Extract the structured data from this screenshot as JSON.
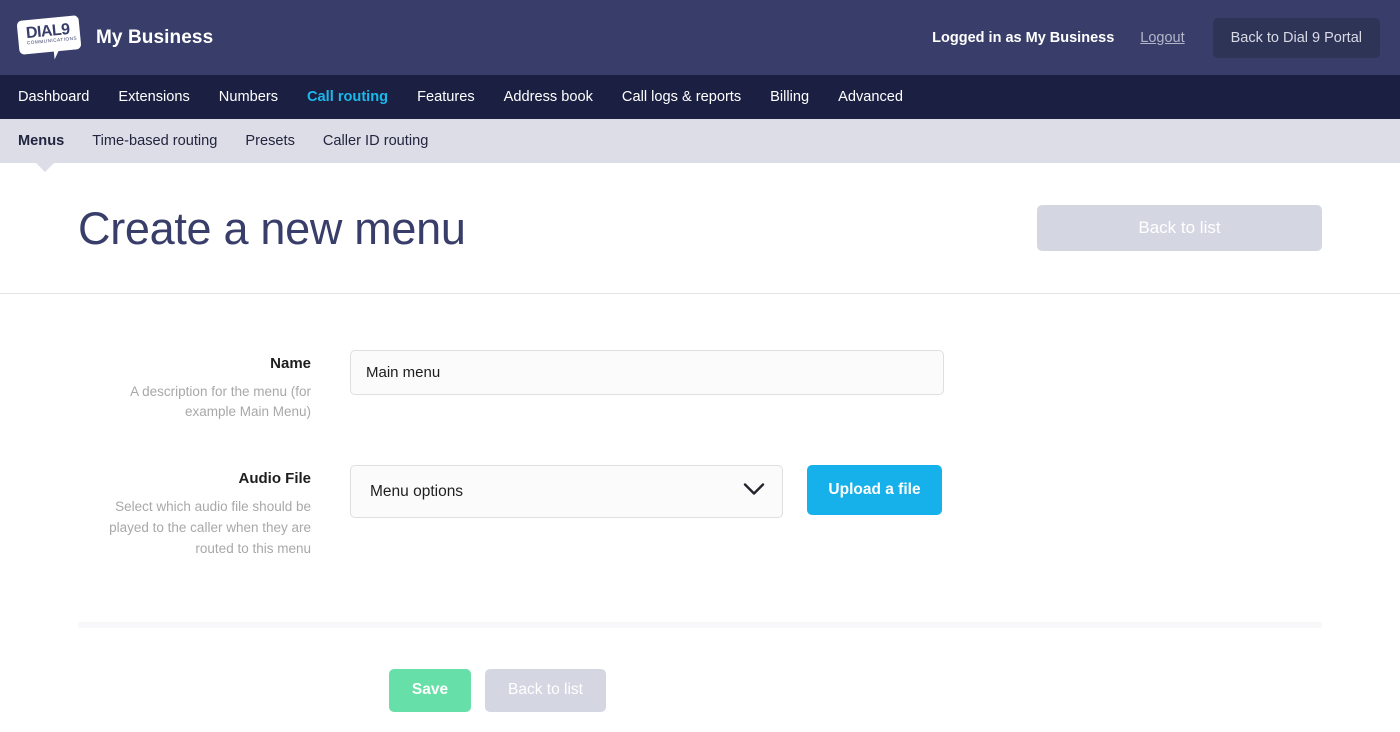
{
  "header": {
    "logo": {
      "icon": "dial9-speech-bubble-logo",
      "primary_text": "DIAL9",
      "trademark": "™",
      "secondary_text": "COMMUNICATIONS"
    },
    "brand_name": "My Business",
    "logged_in_text": "Logged in as My Business",
    "logout_label": "Logout",
    "portal_button_label": "Back to Dial 9 Portal"
  },
  "main_nav": {
    "active": "Call routing",
    "items": [
      {
        "label": "Dashboard",
        "active": false
      },
      {
        "label": "Extensions",
        "active": false
      },
      {
        "label": "Numbers",
        "active": false
      },
      {
        "label": "Call routing",
        "active": true
      },
      {
        "label": "Features",
        "active": false
      },
      {
        "label": "Address book",
        "active": false
      },
      {
        "label": "Call logs & reports",
        "active": false
      },
      {
        "label": "Billing",
        "active": false
      },
      {
        "label": "Advanced",
        "active": false
      }
    ]
  },
  "sub_nav": {
    "active": "Menus",
    "items": [
      {
        "label": "Menus",
        "active": true
      },
      {
        "label": "Time-based routing",
        "active": false
      },
      {
        "label": "Presets",
        "active": false
      },
      {
        "label": "Caller ID routing",
        "active": false
      }
    ]
  },
  "page": {
    "title": "Create a new menu",
    "header_button_label": "Back to list"
  },
  "form": {
    "name_field": {
      "label": "Name",
      "hint": "A description for the menu (for example Main Menu)",
      "value": "Main menu",
      "placeholder": ""
    },
    "audio_field": {
      "label": "Audio File",
      "hint": "Select which audio file should be played to the caller when they are routed to this menu",
      "selected_option": "Menu options",
      "options": [
        "Menu options"
      ],
      "dropdown_icon": "chevron-down-icon",
      "upload_button_label": "Upload a file"
    }
  },
  "footer": {
    "save_label": "Save",
    "back_label": "Back to list"
  },
  "colors": {
    "header_bg": "#383e69",
    "nav_bg": "#1b2042",
    "subnav_bg": "#dcdde6",
    "accent_cyan": "#1bb8ec",
    "upload_blue": "#16b1ea",
    "save_green": "#67dfa8",
    "muted_button": "#d4d6e2",
    "title_navy": "#383e69"
  }
}
